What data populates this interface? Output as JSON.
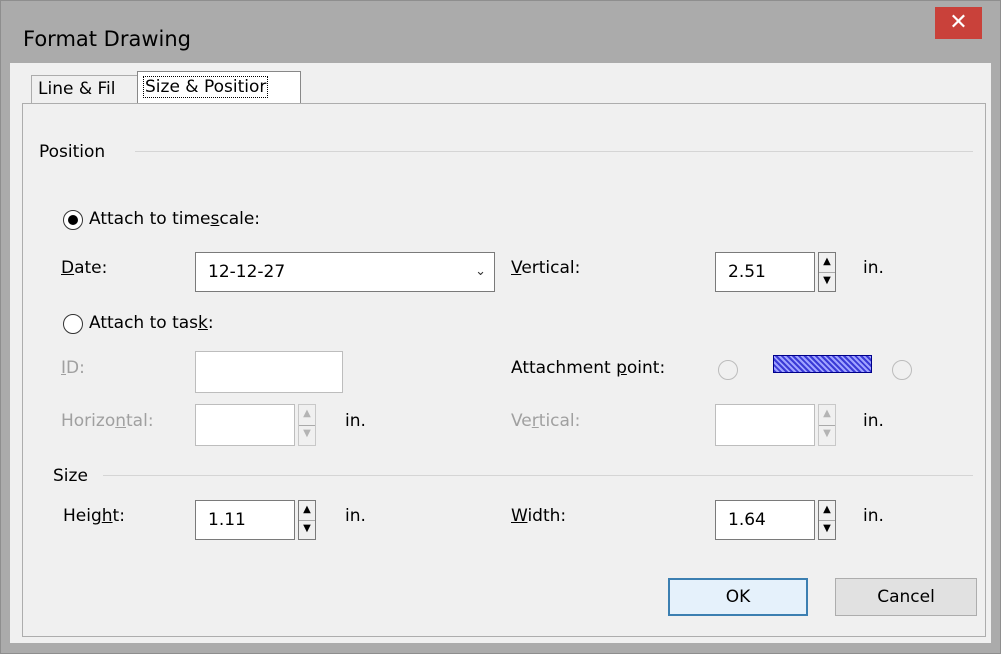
{
  "window": {
    "title": "Format Drawing",
    "close_symbol": "✕"
  },
  "tabs": [
    {
      "label": "Line & Fil",
      "selected": false
    },
    {
      "label": "Size & Positior",
      "selected": true
    }
  ],
  "position": {
    "group_label": "Position",
    "attach_timescale": {
      "label_pre": "Attach to time",
      "label_accel": "s",
      "label_post": "cale:",
      "selected": true
    },
    "date": {
      "label_accel": "D",
      "label_post": "ate:",
      "value": "12-12-27"
    },
    "vertical_top": {
      "label_accel": "V",
      "label_post": "ertical:",
      "value": "2.51",
      "unit": "in."
    },
    "attach_task": {
      "label_pre": "Attach to tas",
      "label_accel": "k",
      "label_post": ":",
      "selected": false
    },
    "id": {
      "label_accel": "I",
      "label_post": "D:",
      "value": ""
    },
    "attachment_point": {
      "label_pre": "Attachment ",
      "label_accel": "p",
      "label_post": "oint:"
    },
    "horizontal": {
      "label_pre": "Horizo",
      "label_accel": "n",
      "label_post": "tal:",
      "value": "",
      "unit": "in."
    },
    "vertical_bottom": {
      "label_pre": "Ve",
      "label_accel": "r",
      "label_post": "tical:",
      "value": "",
      "unit": "in."
    }
  },
  "size": {
    "group_label": "Size",
    "height": {
      "label_pre": "Heig",
      "label_accel": "h",
      "label_post": "t:",
      "value": "1.11",
      "unit": "in."
    },
    "width": {
      "label_accel": "W",
      "label_post": "idth:",
      "value": "1.64",
      "unit": "in."
    }
  },
  "buttons": {
    "ok": "OK",
    "cancel": "Cancel"
  },
  "icons": {
    "spin_up": "▲",
    "spin_down": "▼",
    "dropdown": "⌄"
  },
  "colors": {
    "close_button": "#c9413a",
    "default_button_border": "#3c7fb1"
  }
}
